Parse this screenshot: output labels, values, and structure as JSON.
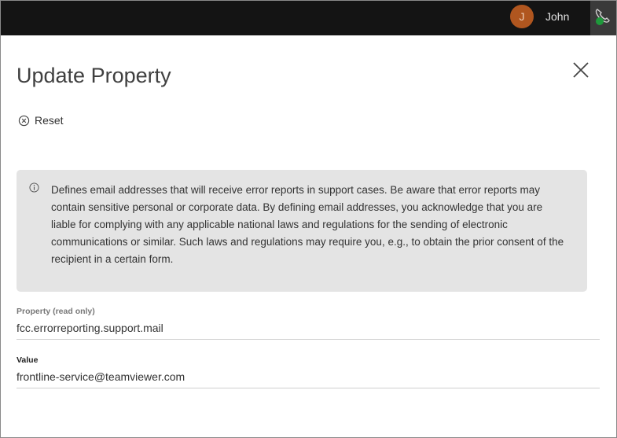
{
  "topbar": {
    "avatar_initial": "J",
    "user_name": "John",
    "call_icon": "phone-icon",
    "status_color": "#1e9a3b"
  },
  "dialog": {
    "title": "Update Property",
    "close_icon": "close-icon",
    "reset_label": "Reset",
    "reset_icon": "circle-x-icon",
    "info_icon": "info-icon",
    "info_text": "Defines email addresses that will receive error reports in support cases. Be aware that error reports may contain sensitive personal or corporate data. By defining email addresses, you acknowledge that you are liable for complying with any applicable national laws and regulations for the sending of electronic communications or similar. Such laws and regulations may require you, e.g., to obtain the prior consent of the recipient in a certain form.",
    "property_label": "Property (read only)",
    "property_value": "fcc.errorreporting.support.mail",
    "value_label": "Value",
    "value_value": "frontline-service@teamviewer.com"
  }
}
